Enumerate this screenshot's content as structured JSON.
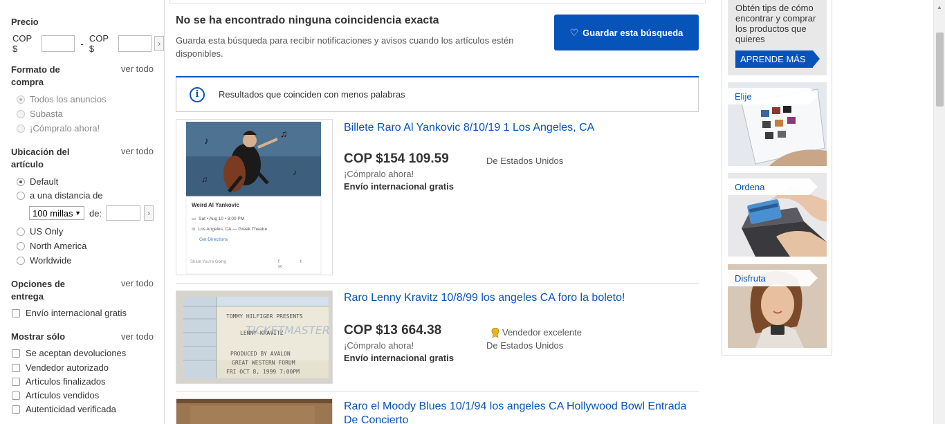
{
  "sidebar": {
    "price": {
      "title": "Precio",
      "min_prefix": "COP $",
      "separator": "-",
      "max_prefix": "COP $",
      "go": "›"
    },
    "format": {
      "title": "Formato de compra",
      "see_all": "ver todo",
      "options": [
        "Todos los anuncios",
        "Subasta",
        "¡Cómpralo ahora!"
      ]
    },
    "location": {
      "title": "Ubicación del artículo",
      "see_all": "ver todo",
      "default_label": "Default",
      "distance_label": "a una distancia de",
      "distance_value": "100 millas",
      "of_label": "de:",
      "go": "›",
      "options": [
        "US Only",
        "North America",
        "Worldwide"
      ]
    },
    "delivery": {
      "title": "Opciones de entrega",
      "see_all": "ver todo",
      "options": [
        "Envío internacional gratis"
      ]
    },
    "show_only": {
      "title": "Mostrar sólo",
      "see_all": "ver todo",
      "options": [
        "Se aceptan devoluciones",
        "Vendedor autorizado",
        "Artículos finalizados",
        "Artículos vendidos",
        "Autenticidad verificada"
      ]
    }
  },
  "main": {
    "no_match_title": "No se ha encontrado ninguna coincidencia exacta",
    "no_match_desc": "Guarda esta búsqueda para recibir notificaciones y avisos cuando los artículos estén disponibles.",
    "save_button": "Guardar esta búsqueda",
    "info_text": "Resultados que coinciden con menos palabras",
    "items": [
      {
        "title": "Billete Raro Al Yankovic 8/10/19 1 Los Angeles, CA",
        "price": "COP $154 109.59",
        "buy_now": "¡Cómpralo ahora!",
        "shipping": "Envío internacional gratis",
        "from": "De Estados Unidos",
        "thumb": {
          "event_name": "Weird Al Yankovic",
          "date": "Sat • Aug 10 • 8:00 PM",
          "venue": "Los Angeles, CA — Greek Theatre",
          "directions": "Get Directions",
          "share": "Share You're Going"
        }
      },
      {
        "title": "Raro Lenny Kravitz 10/8/99 los angeles CA foro la boleto!",
        "price": "COP $13 664.38",
        "buy_now": "¡Cómpralo ahora!",
        "shipping": "Envío internacional gratis",
        "seller": "Vendedor excelente",
        "from": "De Estados Unidos",
        "thumb": {
          "line1": "TOMMY HILFIGER PRESENTS",
          "line2": "LENNY KRAVITZ",
          "line3": "PRODUCED BY AVALON",
          "line4": "GREAT WESTERN FORUM",
          "line5": "FRI OCT 8, 1999 7:00PM"
        }
      },
      {
        "title": "Raro el Moody Blues 10/1/94 los angeles CA Hollywood Bowl Entrada De Concierto"
      }
    ]
  },
  "rail": {
    "tips_text": "Obtén tips de cómo encontrar y comprar los productos que quieres",
    "learn_more": "APRENDE MÁS",
    "promos": [
      "Elije",
      "Ordena",
      "Disfruta"
    ]
  },
  "colors": {
    "accent": "#0654ba",
    "link": "#0654ba",
    "border": "#dddddd"
  }
}
